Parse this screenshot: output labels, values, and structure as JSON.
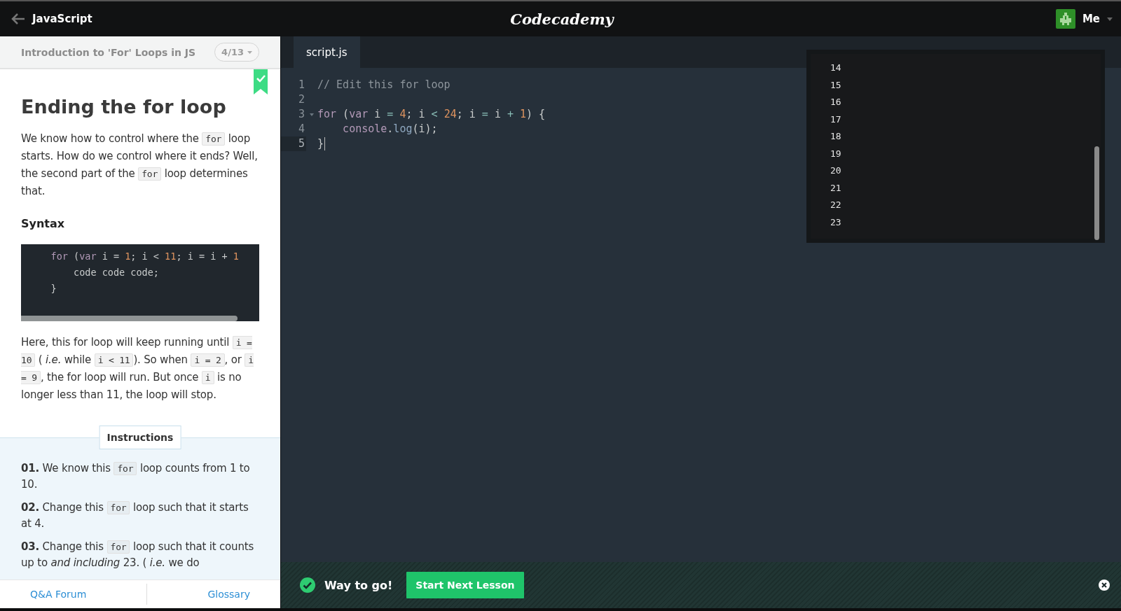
{
  "top_bar": {
    "back_label": "JavaScript",
    "logo": "Codecademy",
    "user": "Me"
  },
  "lesson": {
    "course_title": "Introduction to 'For' Loops in JS",
    "progress": "4/13",
    "completed": true,
    "title": "Ending the for loop",
    "intro": [
      {
        "t": "We know how to control where the ",
        "kind": "text"
      },
      {
        "t": "for",
        "kind": "code"
      },
      {
        "t": " loop starts. How do we control where it ends? Well, the second part of the ",
        "kind": "text"
      },
      {
        "t": "for",
        "kind": "code"
      },
      {
        "t": " loop determines that.",
        "kind": "text"
      }
    ],
    "syntax_heading": "Syntax",
    "syntax_code": [
      {
        "kind": "top",
        "tokens": [
          {
            "t": "for",
            "kind": "keyword"
          },
          {
            "t": " (",
            "kind": "plain"
          },
          {
            "t": "var",
            "kind": "keyword"
          },
          {
            "t": " i = ",
            "kind": "plain"
          },
          {
            "t": "1",
            "kind": "number"
          },
          {
            "t": "; i < ",
            "kind": "plain"
          },
          {
            "t": "11",
            "kind": "number"
          },
          {
            "t": "; i = i + ",
            "kind": "plain"
          },
          {
            "t": "1",
            "kind": "number"
          }
        ]
      },
      {
        "kind": "nested",
        "tokens": [
          {
            "t": "code code code;",
            "kind": "plain"
          }
        ]
      },
      {
        "kind": "top",
        "tokens": [
          {
            "t": "}",
            "kind": "plain"
          }
        ]
      }
    ],
    "explanation": [
      {
        "t": "Here, this for loop will keep running until ",
        "kind": "text"
      },
      {
        "t": "i = 10",
        "kind": "code"
      },
      {
        "t": " ( ",
        "kind": "text"
      },
      {
        "t": "i.e.",
        "kind": "em"
      },
      {
        "t": " while ",
        "kind": "text"
      },
      {
        "t": "i < 11",
        "kind": "code"
      },
      {
        "t": "). So when ",
        "kind": "text"
      },
      {
        "t": "i = 2",
        "kind": "code"
      },
      {
        "t": ", or ",
        "kind": "text"
      },
      {
        "t": "i = 9",
        "kind": "code"
      },
      {
        "t": ", the for loop will run. But once ",
        "kind": "text"
      },
      {
        "t": "i",
        "kind": "code"
      },
      {
        "t": " is no longer less than 11, the loop will stop.",
        "kind": "text"
      }
    ],
    "instructions_label": "Instructions",
    "instructions": [
      {
        "number": "01.",
        "segments": [
          {
            "t": "We know this ",
            "kind": "text"
          },
          {
            "t": "for",
            "kind": "code"
          },
          {
            "t": " loop counts from 1 to 10.",
            "kind": "text"
          }
        ]
      },
      {
        "number": "02.",
        "segments": [
          {
            "t": "Change this ",
            "kind": "text"
          },
          {
            "t": "for",
            "kind": "code"
          },
          {
            "t": " loop such that it starts at 4.",
            "kind": "text"
          }
        ]
      },
      {
        "number": "03.",
        "segments": [
          {
            "t": "Change this ",
            "kind": "text"
          },
          {
            "t": "for",
            "kind": "code"
          },
          {
            "t": " loop such that it counts up to ",
            "kind": "text"
          },
          {
            "t": "and including",
            "kind": "em"
          },
          {
            "t": " 23. ( ",
            "kind": "text"
          },
          {
            "t": "i.e.",
            "kind": "em"
          },
          {
            "t": " we do",
            "kind": "text"
          }
        ]
      }
    ]
  },
  "footer_links": [
    "Q&A Forum",
    "Glossary"
  ],
  "editor": {
    "tabs": [
      {
        "label": "script.js",
        "selected": true
      }
    ],
    "lines": [
      {
        "number": "1",
        "active": false,
        "foldable": false,
        "kind": "top",
        "tokens": [
          {
            "t": "// Edit this for loop",
            "kind": "comment"
          }
        ]
      },
      {
        "number": "2",
        "active": false,
        "foldable": false,
        "kind": "top"
      },
      {
        "number": "3",
        "active": false,
        "foldable": true,
        "kind": "top",
        "tokens": [
          {
            "t": "for",
            "kind": "keyword"
          },
          {
            "t": " (",
            "kind": "plain"
          },
          {
            "t": "var",
            "kind": "keyword"
          },
          {
            "t": " i ",
            "kind": "plain"
          },
          {
            "t": "= ",
            "kind": "operator"
          },
          {
            "t": "4",
            "kind": "number"
          },
          {
            "t": "; i ",
            "kind": "plain"
          },
          {
            "t": "< ",
            "kind": "operator"
          },
          {
            "t": "24",
            "kind": "number"
          },
          {
            "t": "; i ",
            "kind": "plain"
          },
          {
            "t": "= ",
            "kind": "operator"
          },
          {
            "t": "i ",
            "kind": "plain"
          },
          {
            "t": "+ ",
            "kind": "operator"
          },
          {
            "t": "1",
            "kind": "number"
          },
          {
            "t": ") {",
            "kind": "plain"
          }
        ]
      },
      {
        "number": "4",
        "active": false,
        "foldable": false,
        "kind": "nested",
        "tokens": [
          {
            "t": "console",
            "kind": "keyword"
          },
          {
            "t": ".",
            "kind": "plain"
          },
          {
            "t": "log",
            "kind": "property"
          },
          {
            "t": "(i);",
            "kind": "plain"
          }
        ]
      },
      {
        "number": "5",
        "active": true,
        "foldable": false,
        "kind": "top",
        "tokens": [
          {
            "t": "}",
            "kind": "plain"
          }
        ]
      }
    ]
  },
  "console": {
    "lines": [
      "14",
      "15",
      "16",
      "17",
      "18",
      "19",
      "20",
      "21",
      "22",
      "23"
    ]
  },
  "success_bar": {
    "message": "Way to go!",
    "button": "Start Next Lesson"
  }
}
